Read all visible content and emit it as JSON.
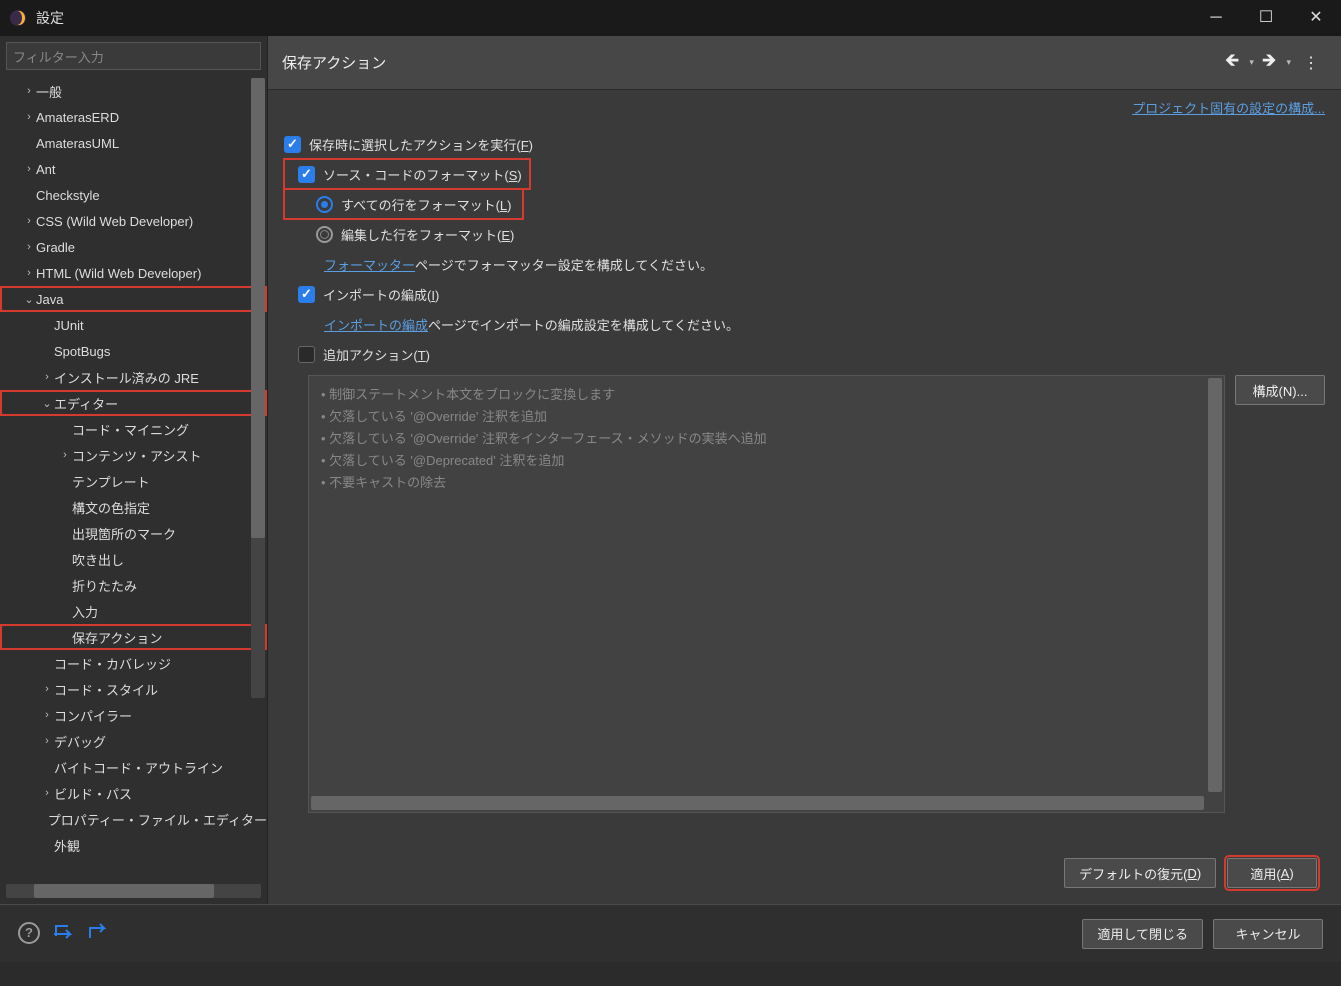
{
  "title": "設定",
  "filter_placeholder": "フィルター入力",
  "tree": [
    {
      "level": 1,
      "chev": ">",
      "label": "一般"
    },
    {
      "level": 1,
      "chev": ">",
      "label": "AmaterasERD"
    },
    {
      "level": 1,
      "chev": "",
      "label": "AmaterasUML"
    },
    {
      "level": 1,
      "chev": ">",
      "label": "Ant"
    },
    {
      "level": 1,
      "chev": "",
      "label": "Checkstyle"
    },
    {
      "level": 1,
      "chev": ">",
      "label": "CSS (Wild Web Developer)"
    },
    {
      "level": 1,
      "chev": ">",
      "label": "Gradle"
    },
    {
      "level": 1,
      "chev": ">",
      "label": "HTML (Wild Web Developer)"
    },
    {
      "level": 1,
      "chev": "v",
      "label": "Java",
      "hl": true
    },
    {
      "level": 2,
      "chev": "",
      "label": "JUnit"
    },
    {
      "level": 2,
      "chev": "",
      "label": "SpotBugs"
    },
    {
      "level": 2,
      "chev": ">",
      "label": "インストール済みの JRE"
    },
    {
      "level": 2,
      "chev": "v",
      "label": "エディター",
      "hl": true
    },
    {
      "level": 3,
      "chev": "",
      "label": "コード・マイニング"
    },
    {
      "level": 3,
      "chev": ">",
      "label": "コンテンツ・アシスト"
    },
    {
      "level": 3,
      "chev": "",
      "label": "テンプレート"
    },
    {
      "level": 3,
      "chev": "",
      "label": "構文の色指定"
    },
    {
      "level": 3,
      "chev": "",
      "label": "出現箇所のマーク"
    },
    {
      "level": 3,
      "chev": "",
      "label": "吹き出し"
    },
    {
      "level": 3,
      "chev": "",
      "label": "折りたたみ"
    },
    {
      "level": 3,
      "chev": "",
      "label": "入力"
    },
    {
      "level": 3,
      "chev": "",
      "label": "保存アクション",
      "hl": true
    },
    {
      "level": 2,
      "chev": "",
      "label": "コード・カバレッジ"
    },
    {
      "level": 2,
      "chev": ">",
      "label": "コード・スタイル"
    },
    {
      "level": 2,
      "chev": ">",
      "label": "コンパイラー"
    },
    {
      "level": 2,
      "chev": ">",
      "label": "デバッグ"
    },
    {
      "level": 2,
      "chev": "",
      "label": "バイトコード・アウトライン"
    },
    {
      "level": 2,
      "chev": ">",
      "label": "ビルド・パス"
    },
    {
      "level": 2,
      "chev": "",
      "label": "プロパティー・ファイル・エディター"
    },
    {
      "level": 2,
      "chev": "",
      "label": "外観"
    }
  ],
  "page": {
    "heading": "保存アクション",
    "project_link": "プロジェクト固有の設定の構成...",
    "chk_perform": "保存時に選択したアクションを実行(",
    "chk_perform_m": "F",
    "chk_format": "ソース・コードのフォーマット(",
    "chk_format_m": "S",
    "radio_all": "すべての行をフォーマット(",
    "radio_all_m": "L",
    "radio_edited": "編集した行をフォーマット(",
    "radio_edited_m": "E",
    "formatter_link": "フォーマッター",
    "formatter_tail": "ページでフォーマッター設定を構成してください。",
    "chk_imports": "インポートの編成(",
    "chk_imports_m": "I",
    "imports_link": "インポートの編成",
    "imports_tail": "ページでインポートの編成設定を構成してください。",
    "chk_additional": "追加アクション(",
    "chk_additional_m": "T",
    "additional_items": [
      "制御ステートメント本文をブロックに変換します",
      "欠落している '@Override' 注釈を追加",
      "欠落している '@Override' 注釈をインターフェース・メソッドの実装へ追加",
      "欠落している '@Deprecated' 注釈を追加",
      "不要キャストの除去"
    ],
    "btn_configure": "構成(N)...",
    "btn_restore": "デフォルトの復元(",
    "btn_restore_m": "D",
    "btn_apply": "適用(",
    "btn_apply_m": "A"
  },
  "footer": {
    "apply_close": "適用して閉じる",
    "cancel": "キャンセル"
  }
}
